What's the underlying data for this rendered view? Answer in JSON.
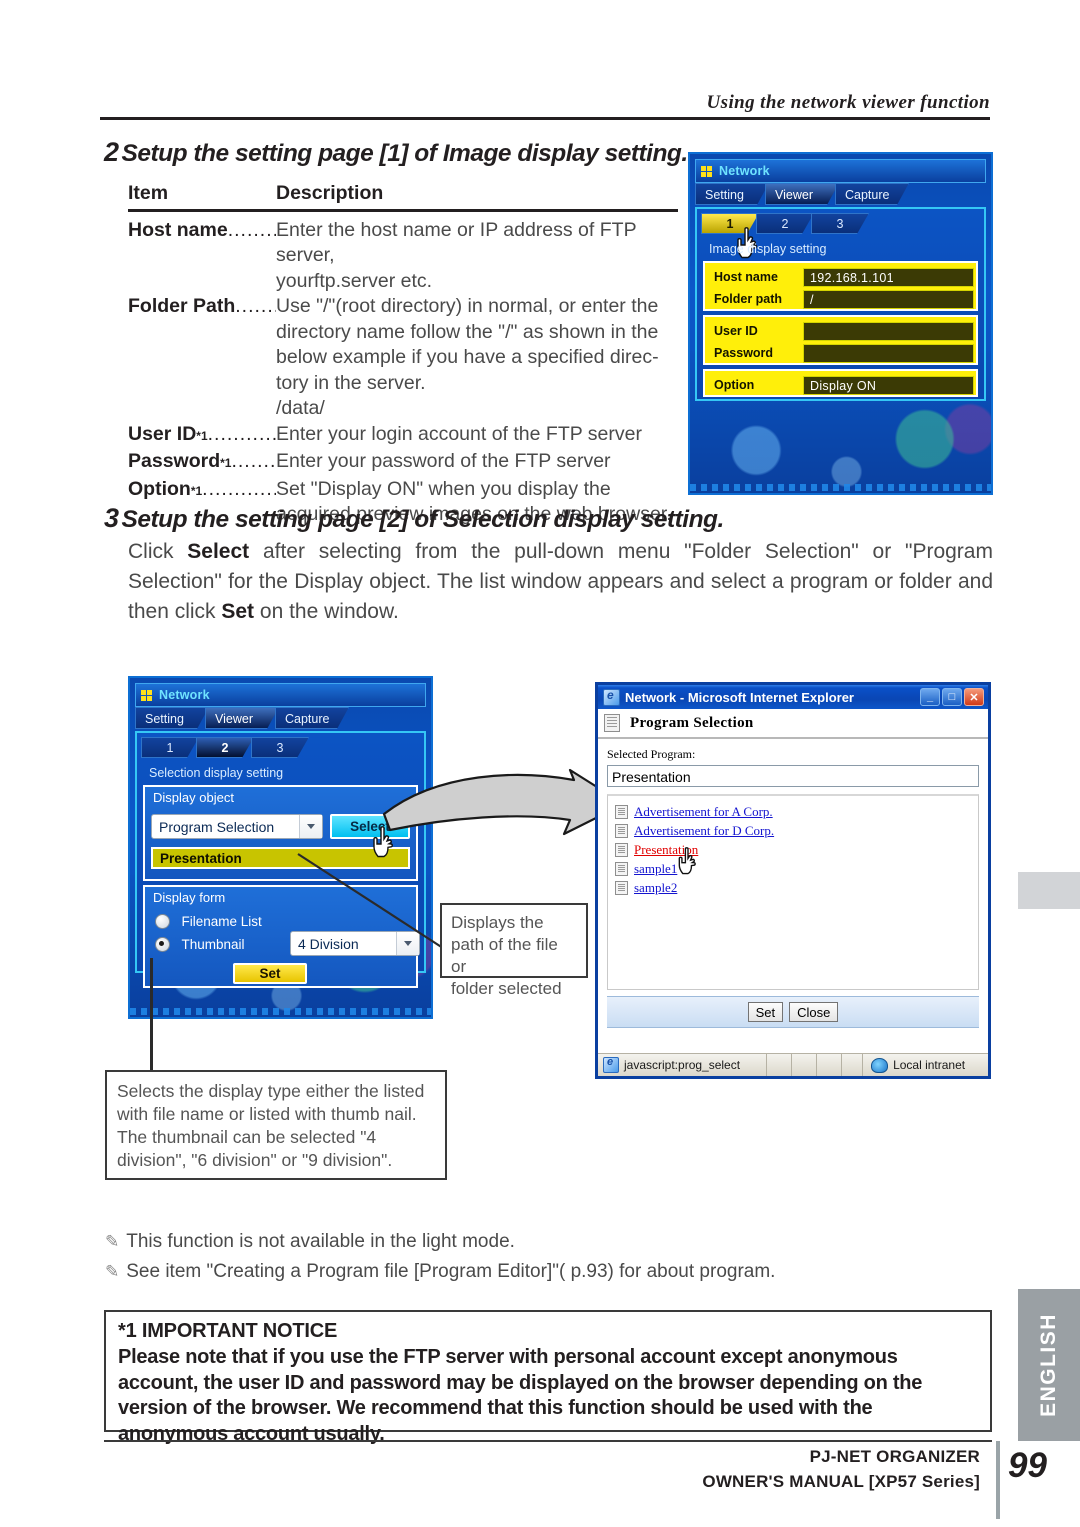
{
  "running_head": "Using the network viewer function",
  "step2": {
    "number": "2",
    "title": "Setup the setting page [1] of Image display setting.",
    "table": {
      "headers": [
        "Item",
        "Description"
      ],
      "rows": [
        {
          "item": "Host name",
          "sup": "",
          "dots": "...........",
          "desc": [
            "Enter the host name or IP address of FTP server,",
            "yourftp.server etc."
          ]
        },
        {
          "item": "Folder Path ",
          "sup": "",
          "dots": ".........",
          "desc": [
            "Use \"/\"(root directory) in normal, or enter the",
            "directory name follow the \"/\" as shown in the",
            "below example if you have a specified direc-",
            "tory in the server.",
            "/data/"
          ]
        },
        {
          "item": "User ID",
          "sup": "*1",
          "dots": "...............",
          "desc": [
            "Enter your login account of the FTP server"
          ]
        },
        {
          "item": "Password",
          "sup": "*1",
          "dots": "..........",
          "desc": [
            "Enter your password of the FTP server"
          ]
        },
        {
          "item": "Option",
          "sup": "*1",
          "dots": "................",
          "desc": [
            "Set \"Display ON\" when you display the",
            "acquired preview images on the web browser."
          ]
        }
      ]
    }
  },
  "osd_image": {
    "window_title": "Network",
    "tabs": [
      {
        "label": "Setting",
        "selected": false
      },
      {
        "label": "Viewer",
        "selected": true
      },
      {
        "label": "Capture",
        "selected": false
      }
    ],
    "page_tabs": [
      {
        "label": "1",
        "current": true
      },
      {
        "label": "2",
        "current": false
      },
      {
        "label": "3",
        "current": false
      }
    ],
    "section_title": "Image display setting",
    "fields": [
      {
        "label": "Host name",
        "value": "192.168.1.101"
      },
      {
        "label": "Folder path",
        "value": "/"
      },
      {
        "label": "User ID",
        "value": ""
      },
      {
        "label": "Password",
        "value": ""
      },
      {
        "label": "Option",
        "value": "Display ON"
      }
    ]
  },
  "step3": {
    "number": "3",
    "title": "Setup the setting page [2] of Selection display setting.",
    "paragraph_parts": [
      {
        "t": "Click ",
        "b": false
      },
      {
        "t": "Select",
        "b": true
      },
      {
        "t": " after selecting from the pull-down menu \"Folder Selection\" or \"Program Selection\" for the Display object.  The list window appears and select a program or folder and then click ",
        "b": false
      },
      {
        "t": "Set",
        "b": true
      },
      {
        "t": " on the window.",
        "b": false
      }
    ]
  },
  "osd_selection": {
    "window_title": "Network",
    "tabs": [
      {
        "label": "Setting",
        "selected": false
      },
      {
        "label": "Viewer",
        "selected": true
      },
      {
        "label": "Capture",
        "selected": false
      }
    ],
    "page_tabs": [
      {
        "label": "1",
        "current": false
      },
      {
        "label": "2",
        "current": true
      },
      {
        "label": "3",
        "current": false
      }
    ],
    "section_title": "Selection display setting",
    "display_object_label": "Display object",
    "display_object_value": "Program Selection",
    "select_button": "Select",
    "selected_item": "Presentation",
    "display_form_label": "Display form",
    "radios": [
      {
        "label": "Filename List",
        "checked": false
      },
      {
        "label": "Thumbnail",
        "checked": true
      }
    ],
    "division_value": "4 Division",
    "set_button": "Set"
  },
  "ie_window": {
    "title": "Network - Microsoft Internet Explorer",
    "win_buttons": {
      "minimize": "_",
      "maximize": "□",
      "close": "✕"
    },
    "header": "Program Selection",
    "field_label": "Selected Program:",
    "field_value": "Presentation",
    "list_items": [
      {
        "label": "Advertisement for A Corp.",
        "current": false
      },
      {
        "label": "Advertisement for D Corp.",
        "current": false
      },
      {
        "label": "Presentation",
        "current": true
      },
      {
        "label": "sample1",
        "current": false
      },
      {
        "label": "sample2",
        "current": false
      }
    ],
    "buttons": [
      "Set",
      "Close"
    ],
    "status_left": "javascript:prog_select",
    "status_zone": "Local intranet"
  },
  "callouts": {
    "path": "Displays the\npath of the file or\nfolder selected",
    "display_type": "Selects the display type either the listed with file name or listed with thumb nail. The thumbnail can be selected \"4 division\", \"6 division\" or \"9 division\"."
  },
  "notes": [
    "This function is not available in the light mode.",
    "See item \"Creating a Program file [Program Editor]\"( p.93)  for about program."
  ],
  "notice": {
    "heading": "*1 IMPORTANT NOTICE",
    "body": "Please note that if you use the FTP server with personal account except anonymous account, the user ID and password may be displayed on the browser depending on the version of the browser. We recommend that this function should be used with the anonymous account usually."
  },
  "footer": {
    "line1": "PJ-NET ORGANIZER",
    "line2": "OWNER'S MANUAL [XP57 Series]",
    "page_number": "99"
  },
  "side_tab": {
    "label": "ENGLISH"
  },
  "colors": {
    "osd_blue": "#0b57c9",
    "osd_yellow": "#ffef0a",
    "ie_title_blue": "#0a46b4",
    "link_blue": "#1414cf",
    "link_current_red": "#e00000",
    "side_tab_gray": "#9aa0a4"
  }
}
